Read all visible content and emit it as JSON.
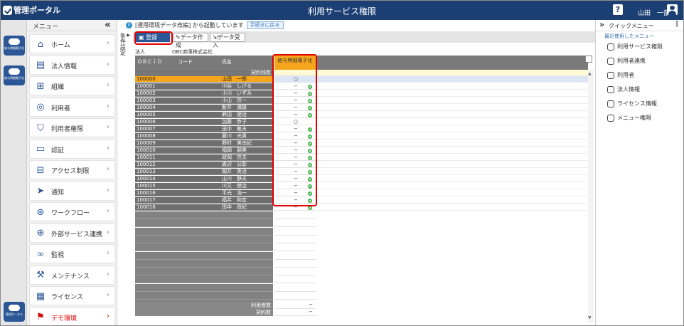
{
  "header": {
    "logo": "管理ポータル",
    "title": "利用サービス権限",
    "help": "?",
    "user": "山田　一部"
  },
  "rail": {
    "btn1": "給与明細電子化",
    "btn2": "給与明細電子化",
    "btn3": "管理ポータル"
  },
  "menu": {
    "label": "メニュー",
    "collapse": "«",
    "items": [
      {
        "label": "ホーム",
        "icon": "home-icon"
      },
      {
        "label": "法人情報",
        "icon": "building-icon"
      },
      {
        "label": "組織",
        "icon": "org-chart-icon"
      },
      {
        "label": "利用者",
        "icon": "users-icon"
      },
      {
        "label": "利用者権限",
        "icon": "shield-icon"
      },
      {
        "label": "認証",
        "icon": "id-card-icon"
      },
      {
        "label": "アクセス制限",
        "icon": "access-restrict-icon"
      },
      {
        "label": "通知",
        "icon": "paper-plane-icon"
      },
      {
        "label": "ワークフロー",
        "icon": "workflow-icon"
      },
      {
        "label": "外部サービス連携",
        "icon": "link-icon"
      },
      {
        "label": "監視",
        "icon": "binoculars-icon"
      },
      {
        "label": "メンテナンス",
        "icon": "hammer-icon"
      },
      {
        "label": "ライセンス",
        "icon": "license-icon"
      },
      {
        "label": "デモ環境",
        "icon": "demo-icon"
      }
    ]
  },
  "info": {
    "text": "[運用環境データ改編] から起動しています",
    "back": "手続きに戻る"
  },
  "condition_label": "条件設定",
  "toolbar": {
    "register": "登録",
    "create": "データ作成",
    "receive": "データ受入"
  },
  "corp": {
    "label": "法人",
    "value": "OBC商事株式会社"
  },
  "grid": {
    "headers": {
      "obcid": "ＯＢＣｉＤ",
      "code": "コード",
      "name": "氏名",
      "service": "給与明細電子化"
    },
    "contract_row": {
      "label": "契約残数",
      "value": "−"
    },
    "rows": [
      {
        "id": "100000",
        "name": "山田　一郎",
        "mark": "○",
        "ok": false
      },
      {
        "id": "100001",
        "name": "川谷　しげる",
        "mark": "−",
        "ok": true
      },
      {
        "id": "100002",
        "name": "小川　いずみ",
        "mark": "−",
        "ok": true
      },
      {
        "id": "100003",
        "name": "小山　信一",
        "mark": "−",
        "ok": true
      },
      {
        "id": "100004",
        "name": "新井　満雄",
        "mark": "−",
        "ok": true
      },
      {
        "id": "100005",
        "name": "麻田　徳治",
        "mark": "−",
        "ok": true
      },
      {
        "id": "100006",
        "name": "加藤　恭子",
        "mark": "○",
        "ok": false
      },
      {
        "id": "100007",
        "name": "田中　敏夫",
        "mark": "−",
        "ok": true
      },
      {
        "id": "100008",
        "name": "藤川　光男",
        "mark": "−",
        "ok": true
      },
      {
        "id": "100009",
        "name": "野村　美由紀",
        "mark": "−",
        "ok": true
      },
      {
        "id": "100010",
        "name": "福岡　朋美",
        "mark": "−",
        "ok": true
      },
      {
        "id": "100011",
        "name": "政岡　信夫",
        "mark": "−",
        "ok": true
      },
      {
        "id": "100012",
        "name": "森沢　公彰",
        "mark": "−",
        "ok": true
      },
      {
        "id": "100013",
        "name": "岡井　英治",
        "mark": "−",
        "ok": true
      },
      {
        "id": "100014",
        "name": "山川　静夫",
        "mark": "−",
        "ok": true
      },
      {
        "id": "100015",
        "name": "川又　徳治",
        "mark": "−",
        "ok": true
      },
      {
        "id": "100016",
        "name": "平光　浩一",
        "mark": "−",
        "ok": true
      },
      {
        "id": "100017",
        "name": "福井　和宏",
        "mark": "−",
        "ok": true
      },
      {
        "id": "100018",
        "name": "田中　政紀",
        "mark": "−",
        "ok": true
      }
    ],
    "footer": {
      "users_label": "利用者数",
      "users_value": "−",
      "contracts_label": "契約数",
      "contracts_value": "−"
    }
  },
  "quick": {
    "label": "クイックメニュー",
    "recent": "最近使用したメニュー",
    "items": [
      {
        "label": "利用サービス権限",
        "icon": "shield-icon"
      },
      {
        "label": "利用者連携",
        "icon": "users-link-icon"
      },
      {
        "label": "利用者",
        "icon": "users-icon"
      },
      {
        "label": "法人情報",
        "icon": "building-icon"
      },
      {
        "label": "ライセンス情報",
        "icon": "license-icon"
      },
      {
        "label": "メニュー権限",
        "icon": "shield-icon"
      }
    ]
  },
  "colors": {
    "header": "#1c3f73",
    "highlight": "#f5a61d",
    "alert": "#e00000",
    "ok": "#3cb043"
  }
}
